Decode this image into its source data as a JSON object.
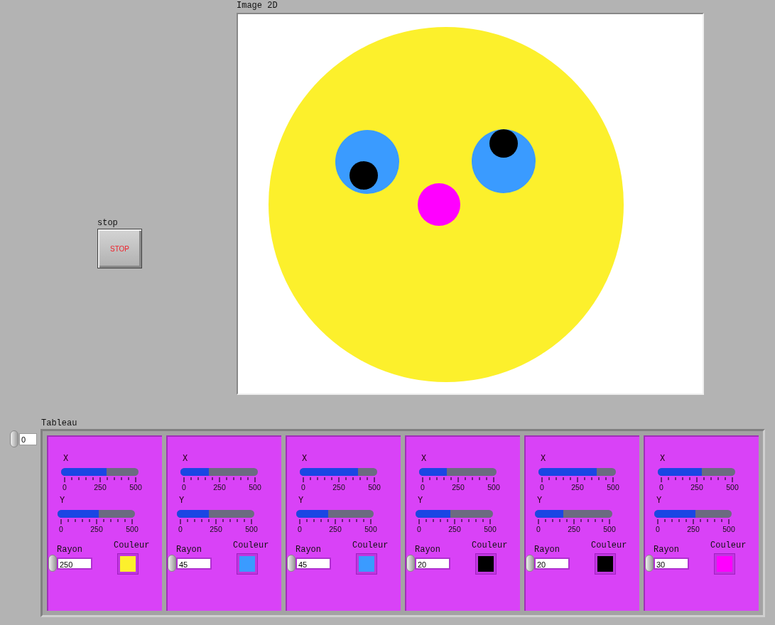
{
  "image": {
    "label": "Image 2D"
  },
  "stop": {
    "label": "stop",
    "button": "STOP"
  },
  "array": {
    "label": "Tableau",
    "index": "0",
    "clusters": [
      {
        "x": {
          "label": "X",
          "level": 0.586,
          "ticks": [
            "0",
            "250",
            "500"
          ]
        },
        "y": {
          "label": "Y",
          "level": 0.536,
          "ticks": [
            "0",
            "250",
            "500"
          ]
        },
        "radius": {
          "label": "Rayon",
          "value": "250"
        },
        "color_label": "Couleur",
        "color": "#fcf02c"
      },
      {
        "x": {
          "label": "X",
          "level": 0.364,
          "ticks": [
            "0",
            "250",
            "500"
          ]
        },
        "y": {
          "label": "Y",
          "level": 0.416,
          "ticks": [
            "0",
            "250",
            "500"
          ]
        },
        "radius": {
          "label": "Rayon",
          "value": "45"
        },
        "color_label": "Couleur",
        "color": "#3a9bff"
      },
      {
        "x": {
          "label": "X",
          "level": 0.748,
          "ticks": [
            "0",
            "250",
            "500"
          ]
        },
        "y": {
          "label": "Y",
          "level": 0.414,
          "ticks": [
            "0",
            "250",
            "500"
          ]
        },
        "radius": {
          "label": "Rayon",
          "value": "45"
        },
        "color_label": "Couleur",
        "color": "#3a9bff"
      },
      {
        "x": {
          "label": "X",
          "level": 0.354,
          "ticks": [
            "0",
            "250",
            "500"
          ]
        },
        "y": {
          "label": "Y",
          "level": 0.454,
          "ticks": [
            "0",
            "250",
            "500"
          ]
        },
        "radius": {
          "label": "Rayon",
          "value": "20"
        },
        "color_label": "Couleur",
        "color": "#000000"
      },
      {
        "x": {
          "label": "X",
          "level": 0.748,
          "ticks": [
            "0",
            "250",
            "500"
          ]
        },
        "y": {
          "label": "Y",
          "level": 0.364,
          "ticks": [
            "0",
            "250",
            "500"
          ]
        },
        "radius": {
          "label": "Rayon",
          "value": "20"
        },
        "color_label": "Couleur",
        "color": "#000000"
      },
      {
        "x": {
          "label": "X",
          "level": 0.566,
          "ticks": [
            "0",
            "250",
            "500"
          ]
        },
        "y": {
          "label": "Y",
          "level": 0.536,
          "ticks": [
            "0",
            "250",
            "500"
          ]
        },
        "radius": {
          "label": "Rayon",
          "value": "30"
        },
        "color_label": "Couleur",
        "color": "#ff00ff"
      }
    ]
  }
}
